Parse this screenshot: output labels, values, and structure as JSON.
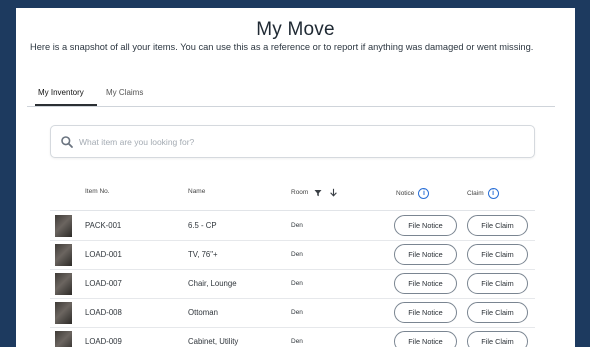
{
  "header": {
    "title": "My Move",
    "subtitle": "Here is a snapshot of all your items. You can use this as a reference or to report if anything was damaged or went missing."
  },
  "tabs": [
    {
      "label": "My Inventory",
      "active": true
    },
    {
      "label": "My Claims",
      "active": false
    }
  ],
  "search": {
    "placeholder": "What item are you looking for?",
    "value": "",
    "icon": "search-icon"
  },
  "table": {
    "columns": {
      "item_no": "Item No.",
      "name": "Name",
      "room": "Room",
      "notice": "Notice",
      "claim": "Claim"
    },
    "rows": [
      {
        "item_no": "PACK-001",
        "name": "6.5 - CP",
        "room": "Den",
        "notice_btn": "File Notice",
        "claim_btn": "File Claim"
      },
      {
        "item_no": "LOAD-001",
        "name": "TV, 76\"+",
        "room": "Den",
        "notice_btn": "File Notice",
        "claim_btn": "File Claim"
      },
      {
        "item_no": "LOAD-007",
        "name": "Chair, Lounge",
        "room": "Den",
        "notice_btn": "File Notice",
        "claim_btn": "File Claim"
      },
      {
        "item_no": "LOAD-008",
        "name": "Ottoman",
        "room": "Den",
        "notice_btn": "File Notice",
        "claim_btn": "File Claim"
      },
      {
        "item_no": "LOAD-009",
        "name": "Cabinet, Utility",
        "room": "Den",
        "notice_btn": "File Notice",
        "claim_btn": "File Claim"
      }
    ]
  },
  "colors": {
    "frame": "#1d3a5f",
    "accent": "#2a6fd6"
  }
}
